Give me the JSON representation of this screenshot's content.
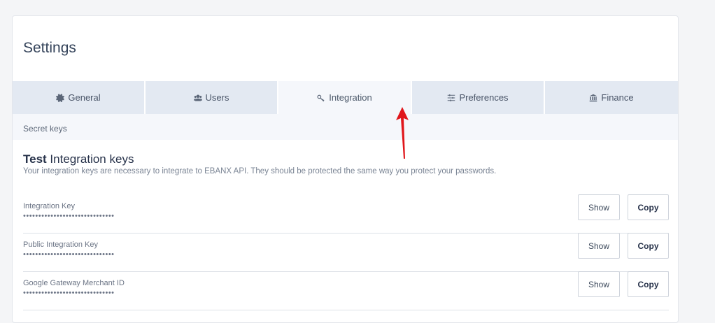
{
  "page": {
    "title": "Settings"
  },
  "tabs": [
    {
      "label": "General",
      "icon": "gear-icon"
    },
    {
      "label": "Users",
      "icon": "users-icon"
    },
    {
      "label": "Integration",
      "icon": "key-icon",
      "active": true
    },
    {
      "label": "Preferences",
      "icon": "sliders-icon"
    },
    {
      "label": "Finance",
      "icon": "bank-icon"
    }
  ],
  "subsection": {
    "label": "Secret keys"
  },
  "section": {
    "heading_bold": "Test",
    "heading_rest": " Integration keys",
    "description": "Your integration keys are necessary to integrate to EBANX API. They should be protected the same way you protect your passwords."
  },
  "keys": [
    {
      "label": "Integration Key",
      "value": "••••••••••••••••••••••••••••••",
      "show_label": "Show",
      "copy_label": "Copy"
    },
    {
      "label": "Public Integration Key",
      "value": "••••••••••••••••••••••••••••••",
      "show_label": "Show",
      "copy_label": "Copy"
    },
    {
      "label": "Google Gateway Merchant ID",
      "value": "••••••••••••••••••••••••••••••",
      "show_label": "Show",
      "copy_label": "Copy"
    }
  ],
  "colors": {
    "accent_arrow": "#e0161b",
    "tab_bg": "#e3e9f2",
    "tab_active_bg": "#f5f7fb"
  }
}
